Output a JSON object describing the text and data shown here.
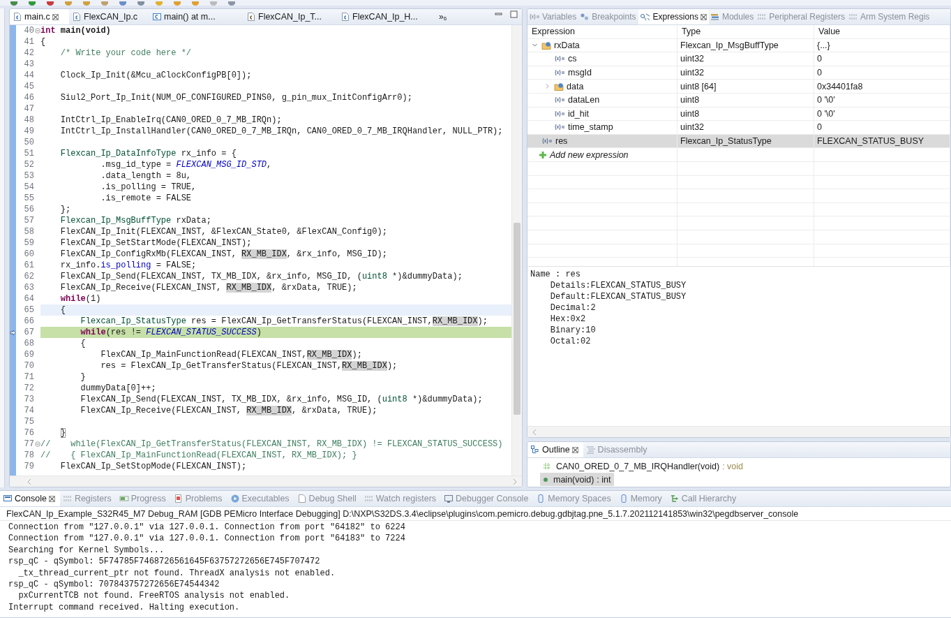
{
  "editor": {
    "tabs": [
      {
        "label": "main.c",
        "kind": "c-file",
        "selected": true
      },
      {
        "label": "FlexCAN_Ip.c",
        "kind": "c-file",
        "selected": false
      },
      {
        "label": "main() at m...",
        "kind": "function",
        "selected": false
      },
      {
        "label": "FlexCAN_Ip_T...",
        "kind": "h-file",
        "selected": false
      },
      {
        "label": "FlexCAN_Ip_H...",
        "kind": "c-file",
        "selected": false
      }
    ],
    "overflow": {
      "symbol": "»",
      "count": "6"
    },
    "lines": [
      {
        "number": "40",
        "foldable": true,
        "executing": false,
        "cursor": false,
        "tokens": [
          {
            "kind": "keyword",
            "text": "int"
          },
          {
            "kind": "declaration",
            "text": " main(void)"
          }
        ]
      },
      {
        "number": "41",
        "foldable": false,
        "executing": false,
        "cursor": false,
        "tokens": [
          {
            "kind": "plain",
            "text": "{"
          }
        ]
      },
      {
        "number": "42",
        "foldable": false,
        "executing": false,
        "cursor": false,
        "tokens": [
          {
            "kind": "comment",
            "text": "    /* Write your code here */"
          }
        ]
      },
      {
        "number": "43",
        "foldable": false,
        "executing": false,
        "cursor": false
      },
      {
        "number": "44",
        "foldable": false,
        "executing": false,
        "cursor": false,
        "tokens": [
          {
            "kind": "plain",
            "text": "    Clock_Ip_Init(&Mcu_aClockConfigPB[0]);"
          }
        ]
      },
      {
        "number": "45",
        "foldable": false,
        "executing": false,
        "cursor": false
      },
      {
        "number": "46",
        "foldable": false,
        "executing": false,
        "cursor": false,
        "tokens": [
          {
            "kind": "plain",
            "text": "    Siul2_Port_Ip_Init(NUM_OF_CONFIGURED_PINS0, g_pin_mux_InitConfigArr0);"
          }
        ]
      },
      {
        "number": "47",
        "foldable": false,
        "executing": false,
        "cursor": false
      },
      {
        "number": "48",
        "foldable": false,
        "executing": false,
        "cursor": false,
        "tokens": [
          {
            "kind": "plain",
            "text": "    IntCtrl_Ip_EnableIrq(CAN0_ORED_0_7_MB_IRQn);"
          }
        ]
      },
      {
        "number": "49",
        "foldable": false,
        "executing": false,
        "cursor": false,
        "tokens": [
          {
            "kind": "plain",
            "text": "    IntCtrl_Ip_InstallHandler(CAN0_ORED_0_7_MB_IRQn, CAN0_ORED_0_7_MB_IRQHandler, NULL_PTR);"
          }
        ]
      },
      {
        "number": "50",
        "foldable": false,
        "executing": false,
        "cursor": false
      },
      {
        "number": "51",
        "foldable": false,
        "executing": false,
        "cursor": false,
        "tokens": [
          {
            "kind": "type",
            "text": "    Flexcan_Ip_DataInfoType"
          },
          {
            "kind": "plain",
            "text": " rx_info = {"
          }
        ]
      },
      {
        "number": "52",
        "foldable": false,
        "executing": false,
        "cursor": false,
        "tokens": [
          {
            "kind": "plain",
            "text": "            .msg_id_type = "
          },
          {
            "kind": "enum",
            "text": "FLEXCAN_MSG_ID_STD"
          },
          {
            "kind": "plain",
            "text": ","
          }
        ]
      },
      {
        "number": "53",
        "foldable": false,
        "executing": false,
        "cursor": false,
        "tokens": [
          {
            "kind": "plain",
            "text": "            .data_length = 8u,"
          }
        ]
      },
      {
        "number": "54",
        "foldable": false,
        "executing": false,
        "cursor": false,
        "tokens": [
          {
            "kind": "plain",
            "text": "            .is_polling = TRUE,"
          }
        ]
      },
      {
        "number": "55",
        "foldable": false,
        "executing": false,
        "cursor": false,
        "tokens": [
          {
            "kind": "plain",
            "text": "            .is_remote = FALSE"
          }
        ]
      },
      {
        "number": "56",
        "foldable": false,
        "executing": false,
        "cursor": false,
        "tokens": [
          {
            "kind": "plain",
            "text": "    };"
          }
        ]
      },
      {
        "number": "57",
        "foldable": false,
        "executing": false,
        "cursor": false,
        "tokens": [
          {
            "kind": "type",
            "text": "    Flexcan_Ip_MsgBuffType"
          },
          {
            "kind": "plain",
            "text": " rxData;"
          }
        ]
      },
      {
        "number": "58",
        "foldable": false,
        "executing": false,
        "cursor": false,
        "tokens": [
          {
            "kind": "plain",
            "text": "    FlexCAN_Ip_Init(FLEXCAN_INST, &FlexCAN_State0, &FlexCAN_Config0);"
          }
        ]
      },
      {
        "number": "59",
        "foldable": false,
        "executing": false,
        "cursor": false,
        "tokens": [
          {
            "kind": "plain",
            "text": "    FlexCAN_Ip_SetStartMode(FLEXCAN_INST);"
          }
        ]
      },
      {
        "number": "60",
        "foldable": false,
        "executing": false,
        "cursor": false,
        "tokens": [
          {
            "kind": "plain",
            "text": "    FlexCAN_Ip_ConfigRxMb(FLEXCAN_INST, "
          },
          {
            "kind": "occurrence",
            "text": "RX_MB_IDX"
          },
          {
            "kind": "plain",
            "text": ", &rx_info, MSG_ID);"
          }
        ]
      },
      {
        "number": "61",
        "foldable": false,
        "executing": false,
        "cursor": false,
        "tokens": [
          {
            "kind": "plain",
            "text": "    rx_info."
          },
          {
            "kind": "field",
            "text": "is_polling"
          },
          {
            "kind": "plain",
            "text": " = FALSE;"
          }
        ]
      },
      {
        "number": "62",
        "foldable": false,
        "executing": false,
        "cursor": false,
        "tokens": [
          {
            "kind": "plain",
            "text": "    FlexCAN_Ip_Send(FLEXCAN_INST, TX_MB_IDX, &rx_info, MSG_ID, ("
          },
          {
            "kind": "type",
            "text": "uint8"
          },
          {
            "kind": "plain",
            "text": " *)&dummyData);"
          }
        ]
      },
      {
        "number": "63",
        "foldable": false,
        "executing": false,
        "cursor": false,
        "tokens": [
          {
            "kind": "plain",
            "text": "    FlexCAN_Ip_Receive(FLEXCAN_INST, "
          },
          {
            "kind": "occurrence",
            "text": "RX_MB_IDX"
          },
          {
            "kind": "plain",
            "text": ", &rxData, TRUE);"
          }
        ]
      },
      {
        "number": "64",
        "foldable": false,
        "executing": false,
        "cursor": false,
        "tokens": [
          {
            "kind": "keyword",
            "text": "    while"
          },
          {
            "kind": "plain",
            "text": "(1)"
          }
        ]
      },
      {
        "number": "65",
        "foldable": false,
        "executing": false,
        "cursor": true,
        "tokens": [
          {
            "kind": "plain",
            "text": "    {"
          }
        ]
      },
      {
        "number": "66",
        "foldable": false,
        "executing": false,
        "cursor": false,
        "tokens": [
          {
            "kind": "type",
            "text": "        Flexcan_Ip_StatusType"
          },
          {
            "kind": "plain",
            "text": " res = FlexCAN_Ip_GetTransferStatus(FLEXCAN_INST,"
          },
          {
            "kind": "occurrence",
            "text": "RX_MB_IDX"
          },
          {
            "kind": "plain",
            "text": ");"
          }
        ]
      },
      {
        "number": "67",
        "foldable": false,
        "executing": true,
        "cursor": false,
        "tokens": [
          {
            "kind": "keyword",
            "text": "        while"
          },
          {
            "kind": "plain",
            "text": "(res != "
          },
          {
            "kind": "enum",
            "text": "FLEXCAN_STATUS_SUCCESS"
          },
          {
            "kind": "plain",
            "text": ")"
          }
        ]
      },
      {
        "number": "68",
        "foldable": false,
        "executing": false,
        "cursor": false,
        "tokens": [
          {
            "kind": "plain",
            "text": "        {"
          }
        ]
      },
      {
        "number": "69",
        "foldable": false,
        "executing": false,
        "cursor": false,
        "tokens": [
          {
            "kind": "plain",
            "text": "            FlexCAN_Ip_MainFunctionRead(FLEXCAN_INST,"
          },
          {
            "kind": "occurrence",
            "text": "RX_MB_IDX"
          },
          {
            "kind": "plain",
            "text": ");"
          }
        ]
      },
      {
        "number": "70",
        "foldable": false,
        "executing": false,
        "cursor": false,
        "tokens": [
          {
            "kind": "plain",
            "text": "            res = FlexCAN_Ip_GetTransferStatus(FLEXCAN_INST,"
          },
          {
            "kind": "occurrence",
            "text": "RX_MB_IDX"
          },
          {
            "kind": "plain",
            "text": ");"
          }
        ]
      },
      {
        "number": "71",
        "foldable": false,
        "executing": false,
        "cursor": false,
        "tokens": [
          {
            "kind": "plain",
            "text": "        }"
          }
        ]
      },
      {
        "number": "72",
        "foldable": false,
        "executing": false,
        "cursor": false,
        "tokens": [
          {
            "kind": "plain",
            "text": "        dummyData[0]++;"
          }
        ]
      },
      {
        "number": "73",
        "foldable": false,
        "executing": false,
        "cursor": false,
        "tokens": [
          {
            "kind": "plain",
            "text": "        FlexCAN_Ip_Send(FLEXCAN_INST, TX_MB_IDX, &rx_info, MSG_ID, ("
          },
          {
            "kind": "type",
            "text": "uint8"
          },
          {
            "kind": "plain",
            "text": " *)&dummyData);"
          }
        ]
      },
      {
        "number": "74",
        "foldable": false,
        "executing": false,
        "cursor": false,
        "tokens": [
          {
            "kind": "plain",
            "text": "        FlexCAN_Ip_Receive(FLEXCAN_INST, "
          },
          {
            "kind": "occurrence",
            "text": "RX_MB_IDX"
          },
          {
            "kind": "plain",
            "text": ", &rxData, TRUE);"
          }
        ]
      },
      {
        "number": "75",
        "foldable": false,
        "executing": false,
        "cursor": false
      },
      {
        "number": "76",
        "foldable": false,
        "executing": false,
        "cursor": false,
        "tokens": [
          {
            "kind": "bracket",
            "text": "    }"
          }
        ]
      },
      {
        "number": "77",
        "foldable": true,
        "executing": false,
        "cursor": false,
        "tokens": [
          {
            "kind": "comment",
            "text": "//    while(FlexCAN_Ip_GetTransferStatus(FLEXCAN_INST, RX_MB_IDX) != FLEXCAN_STATUS_SUCCESS)"
          }
        ]
      },
      {
        "number": "78",
        "foldable": false,
        "executing": false,
        "cursor": false,
        "tokens": [
          {
            "kind": "comment",
            "text": "//    { FlexCAN_Ip_MainFunctionRead(FLEXCAN_INST, RX_MB_IDX); }"
          }
        ]
      },
      {
        "number": "79",
        "foldable": false,
        "executing": false,
        "cursor": false,
        "tokens": [
          {
            "kind": "plain",
            "text": "    FlexCAN_Ip_SetStopMode(FLEXCAN_INST);"
          }
        ]
      }
    ]
  },
  "expressions": {
    "tabs": [
      {
        "label": "Variables",
        "selected": false
      },
      {
        "label": "Breakpoints",
        "selected": false
      },
      {
        "label": "Expressions",
        "selected": true
      },
      {
        "label": "Modules",
        "selected": false
      },
      {
        "label": "Peripheral Registers",
        "selected": false
      },
      {
        "label": "Arm System Regis",
        "selected": false
      }
    ],
    "columns": [
      "Expression",
      "Type",
      "Value"
    ],
    "rows": [
      {
        "kind": "struct",
        "expression": "rxData",
        "type": "Flexcan_Ip_MsgBuffType",
        "value": "{...}",
        "expanded": true,
        "selected": false,
        "children": [
          {
            "kind": "variable",
            "expression": "cs",
            "type": "uint32",
            "value": "0",
            "selected": false
          },
          {
            "kind": "variable",
            "expression": "msgId",
            "type": "uint32",
            "value": "0",
            "selected": false
          },
          {
            "kind": "struct",
            "expression": "data",
            "type": "uint8 [64]",
            "value": "0x34401fa8",
            "expanded": false,
            "selected": false
          },
          {
            "kind": "variable",
            "expression": "dataLen",
            "type": "uint8",
            "value": "0 '\\0'",
            "selected": false
          },
          {
            "kind": "variable",
            "expression": "id_hit",
            "type": "uint8",
            "value": "0 '\\0'",
            "selected": false
          },
          {
            "kind": "variable",
            "expression": "time_stamp",
            "type": "uint32",
            "value": "0",
            "selected": false
          }
        ]
      },
      {
        "kind": "variable",
        "expression": "res",
        "type": "Flexcan_Ip_StatusType",
        "value": "FLEXCAN_STATUS_BUSY",
        "selected": true
      }
    ],
    "add_row": "Add new expression",
    "details": [
      "Name : res",
      "    Details:FLEXCAN_STATUS_BUSY",
      "    Default:FLEXCAN_STATUS_BUSY",
      "    Decimal:2",
      "    Hex:0x2",
      "    Binary:10",
      "    Octal:02"
    ]
  },
  "outline": {
    "tabs": [
      {
        "label": "Outline",
        "selected": true
      },
      {
        "label": "Disassembly",
        "selected": false
      }
    ],
    "items": [
      {
        "kind": "handler",
        "name": "CAN0_ORED_0_7_MB_IRQHandler(void)",
        "return_type": ": void",
        "selected": false
      },
      {
        "kind": "function",
        "name": "main(void)",
        "return_type": ": int",
        "selected": true
      }
    ]
  },
  "console": {
    "tabs": [
      {
        "label": "Console",
        "selected": true
      },
      {
        "label": "Registers",
        "selected": false
      },
      {
        "label": "Progress",
        "selected": false
      },
      {
        "label": "Problems",
        "selected": false
      },
      {
        "label": "Executables",
        "selected": false
      },
      {
        "label": "Debug Shell",
        "selected": false
      },
      {
        "label": "Watch registers",
        "selected": false
      },
      {
        "label": "Debugger Console",
        "selected": false
      },
      {
        "label": "Memory Spaces",
        "selected": false
      },
      {
        "label": "Memory",
        "selected": false
      },
      {
        "label": "Call Hierarchy",
        "selected": false
      }
    ],
    "title": "FlexCAN_Ip_Example_S32R45_M7 Debug_RAM [GDB PEMicro Interface Debugging] D:\\NXP\\S32DS.3.4\\eclipse\\plugins\\com.pemicro.debug.gdbjtag.pne_5.1.7.202112141853\\win32\\pegdbserver_console",
    "output": [
      "Connection from \"127.0.0.1\" via 127.0.0.1. Connection from port \"64182\" to 6224",
      "Connection from \"127.0.0.1\" via 127.0.0.1. Connection from port \"64183\" to 7224",
      "Searching for Kernel Symbols...",
      "rsp_qC - qSymbol: 5F74785F7468726561645F63757272656E745F707472",
      "  _tx_thread_current_ptr not found. ThreadX analysis not enabled.",
      "rsp_qC - qSymbol: 707843757272656E74544342",
      "  pxCurrentTCB not found. FreeRTOS analysis not enabled.",
      "Interrupt command received. Halting execution."
    ]
  }
}
